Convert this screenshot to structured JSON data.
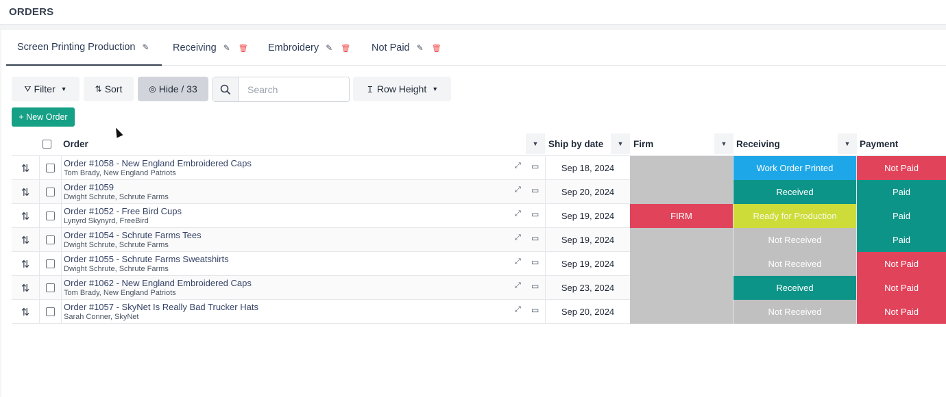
{
  "header": {
    "title": "ORDERS"
  },
  "tabs": [
    {
      "label": "Screen Printing Production",
      "edit_icon": "pencil-icon"
    },
    {
      "label": "Receiving",
      "edit_icon": "pencil-icon",
      "delete_icon": "trash-icon"
    },
    {
      "label": "Embroidery",
      "edit_icon": "pencil-icon",
      "delete_icon": "trash-icon"
    },
    {
      "label": "Not Paid",
      "edit_icon": "pencil-icon",
      "delete_icon": "trash-icon"
    }
  ],
  "toolbar": {
    "filter_label": "Filter",
    "sort_label": "Sort",
    "hide_label": "Hide / 33",
    "search_placeholder": "Search",
    "row_height_label": "Row Height",
    "new_order_label": "+ New Order"
  },
  "columns": {
    "order": "Order",
    "ship_by": "Ship by date",
    "firm": "Firm",
    "receiving": "Receiving",
    "payment": "Payment"
  },
  "colors": {
    "accent": "#16a085",
    "firm_red": "#e0435a",
    "work_order_blue": "#1ea7e8",
    "received_teal": "#0d9488",
    "ready_yellow": "#cddc39",
    "not_received_gray": "#c0c0c0",
    "paid_teal": "#0d9488",
    "not_paid_red": "#e0435a",
    "empty_gray": "#c4c4c4"
  },
  "rows": [
    {
      "title": "Order #1058 - New England Embroidered Caps",
      "sub": "Tom Brady, New England Patriots",
      "ship": "Sep 18, 2024",
      "firm": "",
      "receiving": "Work Order Printed",
      "payment": "Not Paid"
    },
    {
      "title": "Order #1059",
      "sub": "Dwight Schrute, Schrute Farms",
      "ship": "Sep 20, 2024",
      "firm": "",
      "receiving": "Received",
      "payment": "Paid"
    },
    {
      "title": "Order #1052 - Free Bird Cups",
      "sub": "Lynyrd Skynyrd, FreeBird",
      "ship": "Sep 19, 2024",
      "firm": "FIRM",
      "receiving": "Ready for Production",
      "payment": "Paid"
    },
    {
      "title": "Order #1054 - Schrute Farms Tees",
      "sub": "Dwight Schrute, Schrute Farms",
      "ship": "Sep 19, 2024",
      "firm": "",
      "receiving": "Not Received",
      "payment": "Paid"
    },
    {
      "title": "Order #1055 - Schrute Farms Sweatshirts",
      "sub": "Dwight Schrute, Schrute Farms",
      "ship": "Sep 19, 2024",
      "firm": "",
      "receiving": "Not Received",
      "payment": "Not Paid"
    },
    {
      "title": "Order #1062 - New England Embroidered Caps",
      "sub": "Tom Brady, New England Patriots",
      "ship": "Sep 23, 2024",
      "firm": "",
      "receiving": "Received",
      "payment": "Not Paid"
    },
    {
      "title": "Order #1057 - SkyNet Is Really Bad Trucker Hats",
      "sub": "Sarah Conner, SkyNet",
      "ship": "Sep 20, 2024",
      "firm": "",
      "receiving": "Not Received",
      "payment": "Not Paid"
    }
  ]
}
